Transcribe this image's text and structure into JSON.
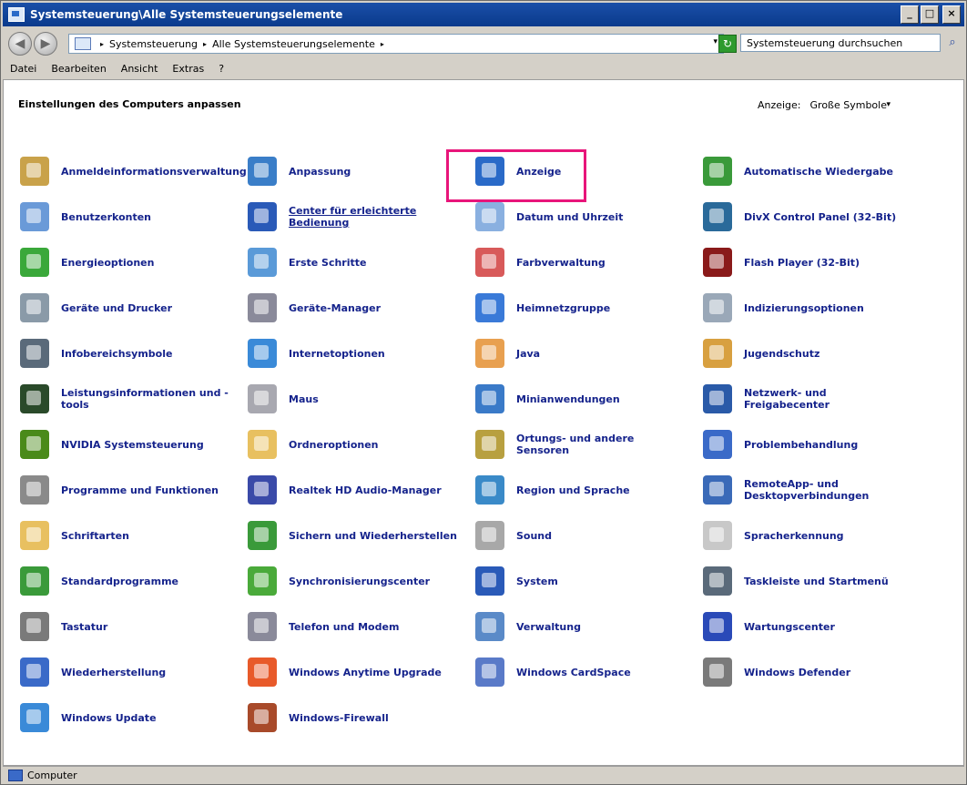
{
  "window": {
    "title": "Systemsteuerung\\Alle Systemsteuerungselemente",
    "buttons": {
      "minimize": "_",
      "maximize": "□",
      "close": "×"
    }
  },
  "address": {
    "back": "◀",
    "forward": "▶",
    "crumbs": [
      "Systemsteuerung",
      "Alle Systemsteuerungselemente"
    ],
    "dropdown": "▾",
    "refresh": "↻",
    "search_placeholder": "Systemsteuerung durchsuchen",
    "search_icon": "⌕"
  },
  "menu": [
    "Datei",
    "Bearbeiten",
    "Ansicht",
    "Extras",
    "?"
  ],
  "content": {
    "heading": "Einstellungen des Computers anpassen",
    "view_label": "Anzeige:",
    "view_value": "Große Symbole",
    "view_dropdown": "▾"
  },
  "items": [
    {
      "label": "Anmeldeinformationsverwaltung",
      "icon": "credential-vault-icon",
      "color": "#c9a24a"
    },
    {
      "label": "Anpassung",
      "icon": "personalization-icon",
      "color": "#3a7ec8"
    },
    {
      "label": "Anzeige",
      "icon": "display-icon",
      "color": "#2a6ac8"
    },
    {
      "label": "Automatische Wiedergabe",
      "icon": "autoplay-icon",
      "color": "#3a9a3a"
    },
    {
      "label": "Benutzerkonten",
      "icon": "user-accounts-icon",
      "color": "#6a9ad8"
    },
    {
      "label": "Center für erleichterte Bedienung",
      "icon": "ease-of-access-icon",
      "color": "#2a5ab8"
    },
    {
      "label": "Datum und Uhrzeit",
      "icon": "calendar-clock-icon",
      "color": "#8ab0e0"
    },
    {
      "label": "DivX Control Panel (32-Bit)",
      "icon": "divx-icon",
      "color": "#2a6a9a"
    },
    {
      "label": "Energieoptionen",
      "icon": "power-icon",
      "color": "#3aa83a"
    },
    {
      "label": "Erste Schritte",
      "icon": "getting-started-icon",
      "color": "#5a9ad8"
    },
    {
      "label": "Farbverwaltung",
      "icon": "color-management-icon",
      "color": "#d85a5a"
    },
    {
      "label": "Flash Player (32-Bit)",
      "icon": "flash-icon",
      "color": "#8a1a1a"
    },
    {
      "label": "Geräte und Drucker",
      "icon": "printer-icon",
      "color": "#8a9aa8"
    },
    {
      "label": "Geräte-Manager",
      "icon": "device-manager-icon",
      "color": "#8a8a9a"
    },
    {
      "label": "Heimnetzgruppe",
      "icon": "homegroup-icon",
      "color": "#3a7ad8"
    },
    {
      "label": "Indizierungsoptionen",
      "icon": "indexing-icon",
      "color": "#9aa8b8"
    },
    {
      "label": "Infobereichsymbole",
      "icon": "notification-icons-icon",
      "color": "#5a6a7a"
    },
    {
      "label": "Internetoptionen",
      "icon": "internet-options-icon",
      "color": "#3a8ad8"
    },
    {
      "label": "Java",
      "icon": "java-icon",
      "color": "#e8a050"
    },
    {
      "label": "Jugendschutz",
      "icon": "parental-controls-icon",
      "color": "#d8a040"
    },
    {
      "label": "Leistungsinformationen und -tools",
      "icon": "performance-icon",
      "color": "#2a4a2a"
    },
    {
      "label": "Maus",
      "icon": "mouse-icon",
      "color": "#a8a8b0"
    },
    {
      "label": "Minianwendungen",
      "icon": "gadgets-icon",
      "color": "#3a7ac8"
    },
    {
      "label": "Netzwerk- und Freigabecenter",
      "icon": "network-center-icon",
      "color": "#2a5aa8"
    },
    {
      "label": "NVIDIA Systemsteuerung",
      "icon": "nvidia-icon",
      "color": "#4a8a1a"
    },
    {
      "label": "Ordneroptionen",
      "icon": "folder-options-icon",
      "color": "#e8c060"
    },
    {
      "label": "Ortungs- und andere Sensoren",
      "icon": "sensors-icon",
      "color": "#b8a040"
    },
    {
      "label": "Problembehandlung",
      "icon": "troubleshooting-icon",
      "color": "#3a6ac8"
    },
    {
      "label": "Programme und Funktionen",
      "icon": "programs-icon",
      "color": "#8a8a8a"
    },
    {
      "label": "Realtek HD Audio-Manager",
      "icon": "realtek-icon",
      "color": "#3a4aa8"
    },
    {
      "label": "Region und Sprache",
      "icon": "region-icon",
      "color": "#3a8ac8"
    },
    {
      "label": "RemoteApp- und Desktopverbindungen",
      "icon": "remoteapp-icon",
      "color": "#3a6ab8"
    },
    {
      "label": "Schriftarten",
      "icon": "fonts-icon",
      "color": "#e8c060"
    },
    {
      "label": "Sichern und Wiederherstellen",
      "icon": "backup-icon",
      "color": "#3a9a3a"
    },
    {
      "label": "Sound",
      "icon": "sound-icon",
      "color": "#a8a8a8"
    },
    {
      "label": "Spracherkennung",
      "icon": "speech-icon",
      "color": "#c8c8c8"
    },
    {
      "label": "Standardprogramme",
      "icon": "default-programs-icon",
      "color": "#3a9a3a"
    },
    {
      "label": "Synchronisierungscenter",
      "icon": "sync-icon",
      "color": "#4aaa3a"
    },
    {
      "label": "System",
      "icon": "system-icon",
      "color": "#2a5ab8"
    },
    {
      "label": "Taskleiste und Startmenü",
      "icon": "taskbar-icon",
      "color": "#5a6a7a"
    },
    {
      "label": "Tastatur",
      "icon": "keyboard-icon",
      "color": "#7a7a7a"
    },
    {
      "label": "Telefon und Modem",
      "icon": "phone-icon",
      "color": "#8a8a9a"
    },
    {
      "label": "Verwaltung",
      "icon": "administration-icon",
      "color": "#5a8ac8"
    },
    {
      "label": "Wartungscenter",
      "icon": "action-center-icon",
      "color": "#2a4ab8"
    },
    {
      "label": "Wiederherstellung",
      "icon": "recovery-icon",
      "color": "#3a6ac8"
    },
    {
      "label": "Windows Anytime Upgrade",
      "icon": "windows-logo-icon",
      "color": "#e85a2a"
    },
    {
      "label": "Windows CardSpace",
      "icon": "cardspace-icon",
      "color": "#5a7ac8"
    },
    {
      "label": "Windows Defender",
      "icon": "defender-icon",
      "color": "#7a7a7a"
    },
    {
      "label": "Windows Update",
      "icon": "windows-update-icon",
      "color": "#3a8ad8"
    },
    {
      "label": "Windows-Firewall",
      "icon": "firewall-icon",
      "color": "#a84a2a"
    }
  ],
  "status": {
    "text": "Computer"
  }
}
